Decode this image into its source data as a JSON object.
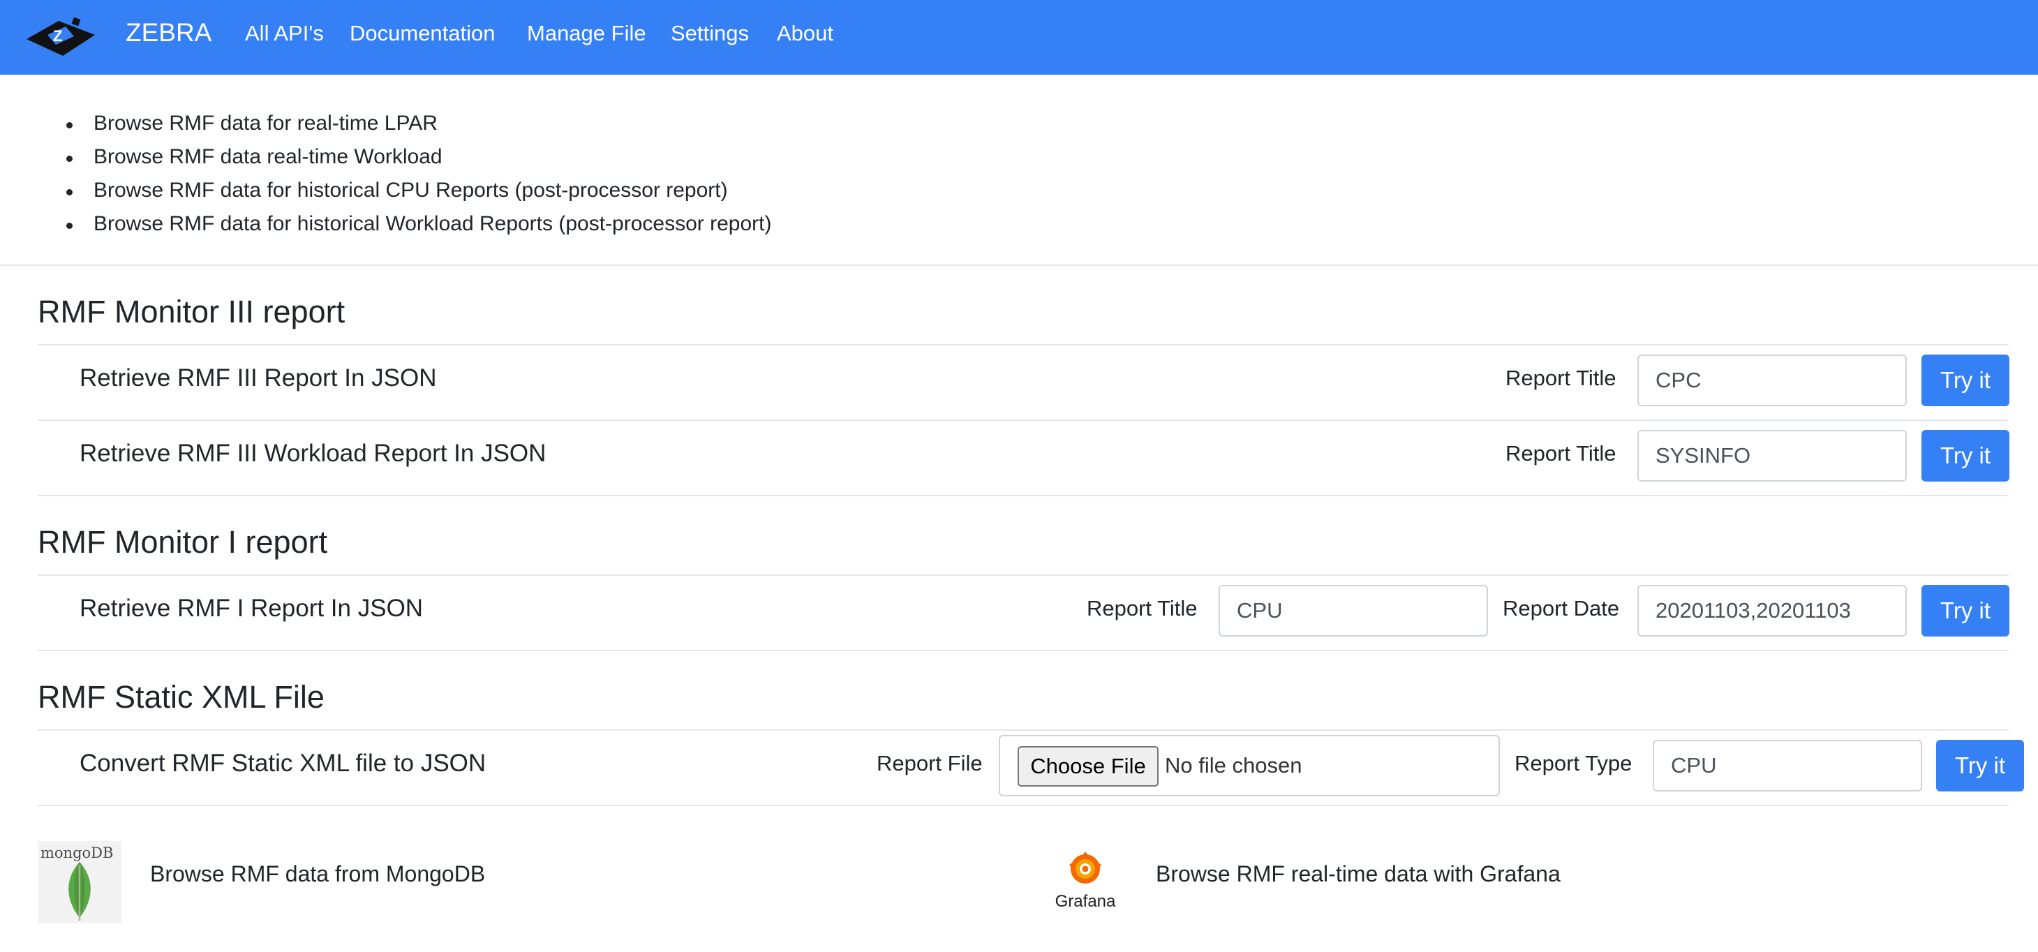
{
  "app": {
    "brand": "ZEBRA",
    "nav": [
      "All API's",
      "Documentation",
      "Manage File",
      "Settings",
      "About"
    ],
    "accent_color": "#3580f4"
  },
  "intro": [
    "Browse RMF data for real-time LPAR",
    "Browse RMF data real-time Workload",
    "Browse RMF data for historical CPU Reports (post-processor report)",
    "Browse RMF data for historical Workload Reports (post-processor report)"
  ],
  "monitor3": {
    "title": "RMF Monitor III report",
    "rows": [
      {
        "label": "Retrieve RMF III Report In JSON",
        "field_label": "Report Title",
        "value": "CPC",
        "button": "Try it"
      },
      {
        "label": "Retrieve RMF III Workload Report In JSON",
        "field_label": "Report Title",
        "value": "SYSINFO",
        "button": "Try it"
      }
    ]
  },
  "monitor1": {
    "title": "RMF Monitor I report",
    "row": {
      "label": "Retrieve RMF I Report In JSON",
      "title_label": "Report Title",
      "title_value": "CPU",
      "date_label": "Report Date",
      "date_value": "20201103,20201103",
      "button": "Try it"
    }
  },
  "static_xml": {
    "title": "RMF Static XML File",
    "row": {
      "label": "Convert RMF Static XML file to JSON",
      "file_label": "Report File",
      "choose_button": "Choose File",
      "file_status": "No file chosen",
      "type_label": "Report Type",
      "type_value": "CPU",
      "button": "Try it"
    }
  },
  "footer": {
    "mongo_logo_text": "mongoDB",
    "mongo_link": "Browse RMF data from MongoDB",
    "grafana_logo_text": "Grafana",
    "grafana_link": "Browse RMF real-time data with Grafana"
  },
  "icons": {
    "logo": "zebra-logo-icon",
    "mongo": "mongodb-leaf-icon",
    "grafana": "grafana-swirl-icon"
  }
}
